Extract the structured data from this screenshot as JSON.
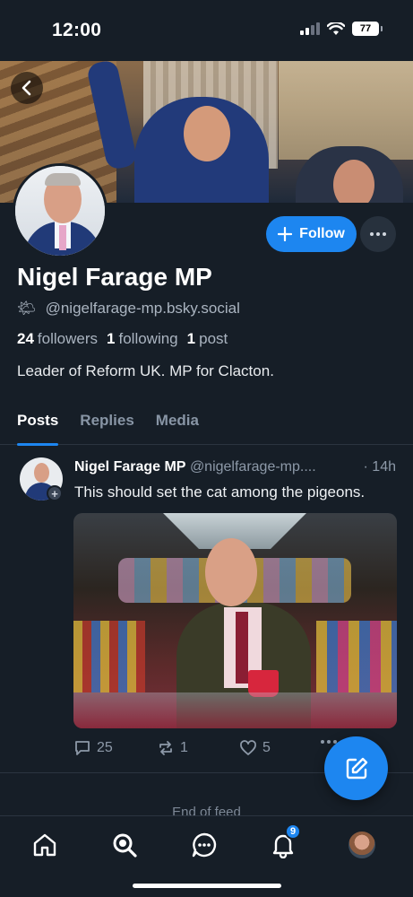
{
  "status_bar": {
    "time": "12:00",
    "battery": "77",
    "icons": [
      "signal-icon",
      "wifi-icon",
      "battery-icon"
    ]
  },
  "colors": {
    "background": "#161e27",
    "accent": "#1d86f0",
    "muted_text": "#8d99a8"
  },
  "profile": {
    "display_name": "Nigel Farage MP",
    "handle": "@nigelfarage-mp.bsky.social",
    "handle_icon": "sun-cloud-emoji",
    "handle_emoji": "🌤",
    "followers_count": "24",
    "followers_label": "followers",
    "following_count": "1",
    "following_label": "following",
    "posts_count": "1",
    "posts_label": "post",
    "bio": "Leader of Reform UK. MP for Clacton.",
    "follow_label": "Follow"
  },
  "tabs": [
    {
      "label": "Posts",
      "active": true
    },
    {
      "label": "Replies",
      "active": false
    },
    {
      "label": "Media",
      "active": false
    }
  ],
  "post": {
    "author": "Nigel Farage MP",
    "handle": "@nigelfarage-mp....",
    "time": "· 14h",
    "text": "This should set the cat among the pigeons.",
    "reply_count": "25",
    "repost_count": "1",
    "like_count": "5"
  },
  "feed": {
    "end_label": "End of feed"
  },
  "bottom_nav": {
    "items": [
      "home-icon",
      "search-icon",
      "chat-icon",
      "bell-icon",
      "avatar"
    ],
    "notification_badge": "9"
  }
}
